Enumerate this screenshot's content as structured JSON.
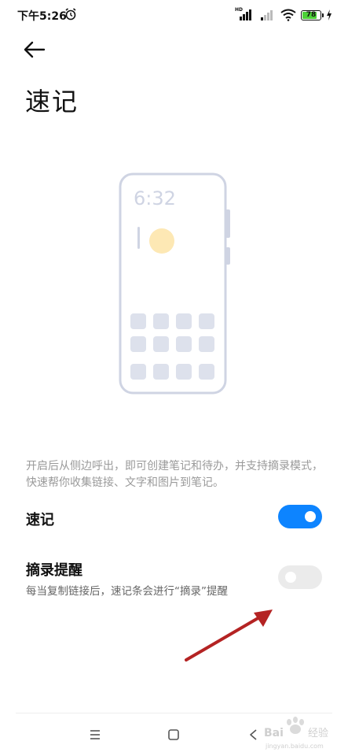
{
  "status_bar": {
    "time": "下午5:26",
    "network_label": "HD",
    "battery_level": "78",
    "icons": [
      "alarm-icon",
      "signal-icon",
      "wifi-icon",
      "battery-icon",
      "charging-icon"
    ]
  },
  "header": {
    "back_icon": "arrow-left-icon",
    "title": "速记"
  },
  "illustration": {
    "clock_text": "6:32",
    "accent_color": "#fde8b4",
    "outline_color": "#cfd4e3"
  },
  "description": "开启后从侧边呼出，即可创建笔记和待办，并支持摘录模式，快速帮你收集链接、文字和图片到笔记。",
  "settings": {
    "quick_note": {
      "title": "速记",
      "enabled": true
    },
    "excerpt_reminder": {
      "title": "摘录提醒",
      "subtitle": "每当复制链接后，速记条会进行“摘录”提醒",
      "enabled": false
    }
  },
  "annotation": {
    "arrow_color": "#b42323"
  },
  "nav_bar": {
    "icons": [
      "menu-icon",
      "home-icon",
      "back-triangle-icon"
    ]
  },
  "watermark": {
    "text": "Bai 经验",
    "subtext": "jingyan.baidu.com"
  },
  "colors": {
    "toggle_on": "#0d84ff",
    "toggle_off": "#ebebeb"
  }
}
